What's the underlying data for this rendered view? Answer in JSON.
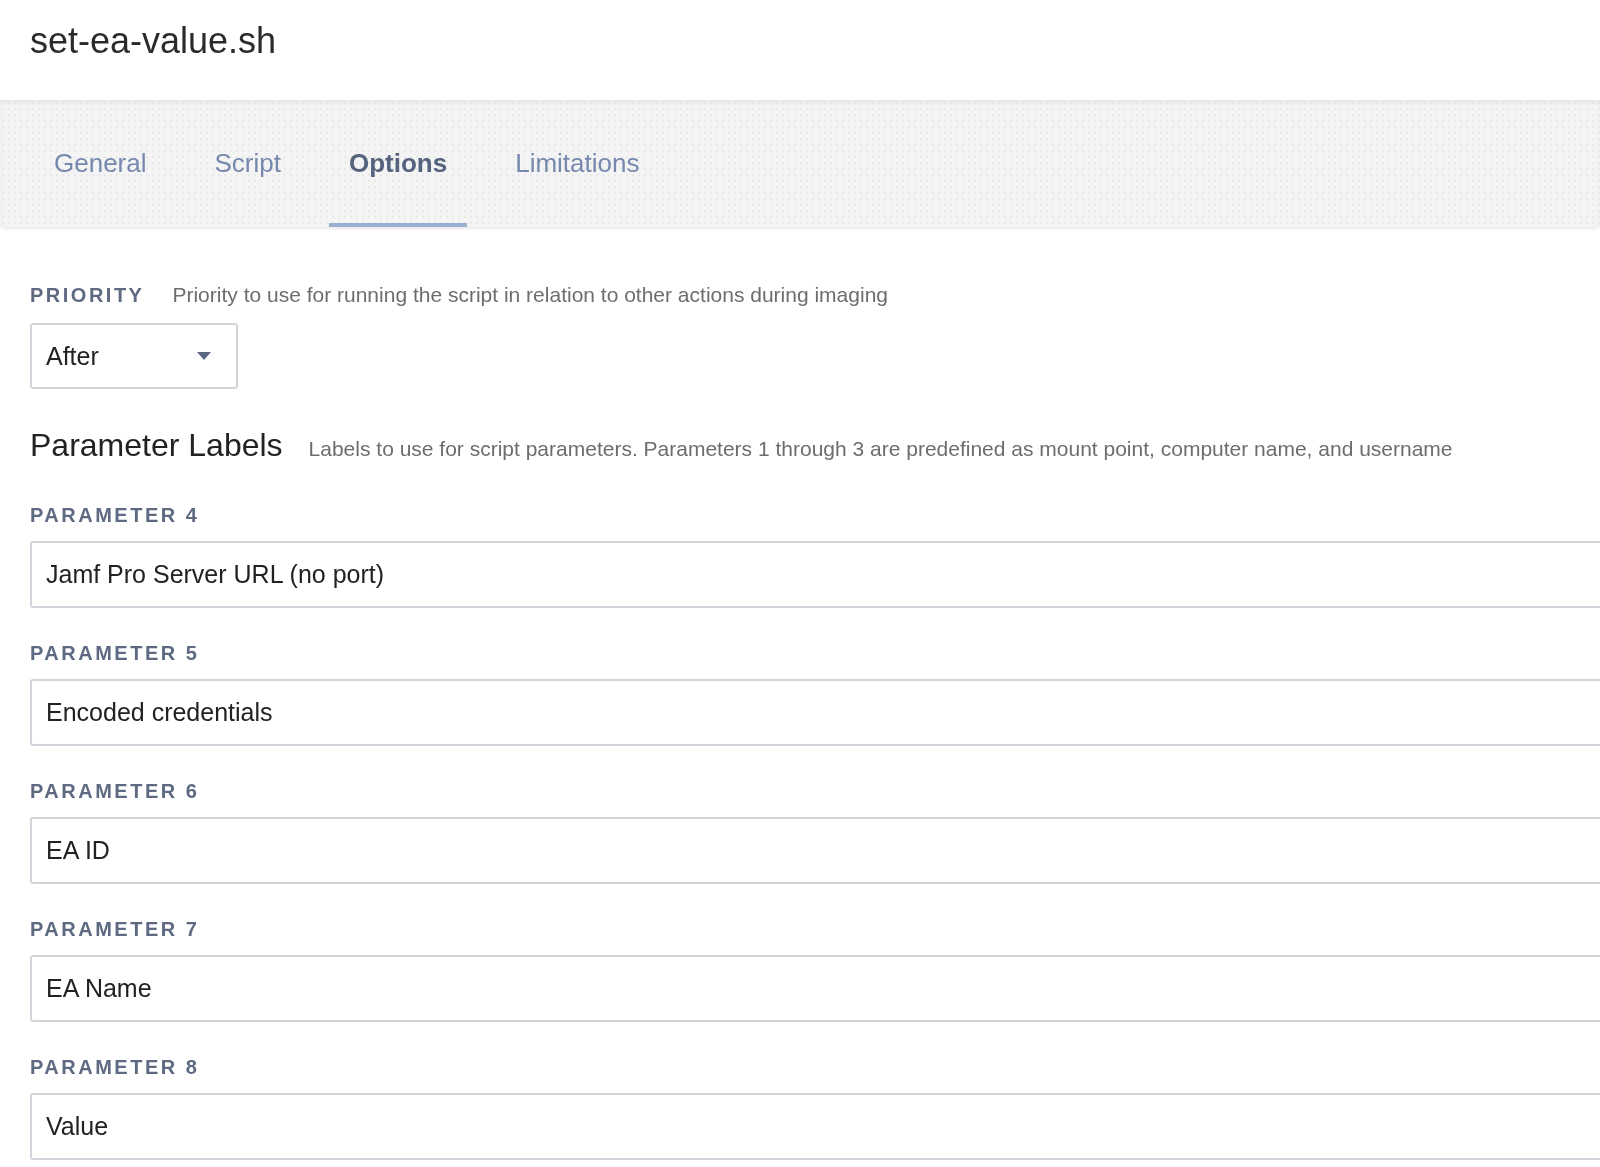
{
  "page": {
    "title": "set-ea-value.sh"
  },
  "tabs": [
    {
      "label": "General",
      "selected": false
    },
    {
      "label": "Script",
      "selected": false
    },
    {
      "label": "Options",
      "selected": true
    },
    {
      "label": "Limitations",
      "selected": false
    }
  ],
  "priority": {
    "label": "PRIORITY",
    "description": "Priority to use for running the script in relation to other actions during imaging",
    "value": "After"
  },
  "parameter_labels": {
    "heading": "Parameter Labels",
    "description": "Labels to use for script parameters. Parameters 1 through 3 are predefined as mount point, computer name, and username",
    "parameters": [
      {
        "label": "PARAMETER 4",
        "value": "Jamf Pro Server URL (no port)"
      },
      {
        "label": "PARAMETER 5",
        "value": "Encoded credentials"
      },
      {
        "label": "PARAMETER 6",
        "value": "EA ID"
      },
      {
        "label": "PARAMETER 7",
        "value": "EA Name"
      },
      {
        "label": "PARAMETER 8",
        "value": "Value"
      }
    ]
  }
}
